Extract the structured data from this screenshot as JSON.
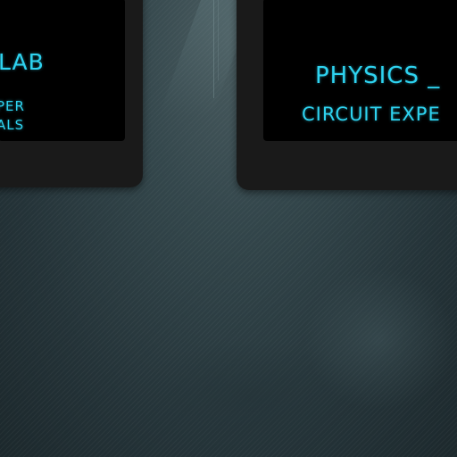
{
  "tiles": {
    "left": {
      "title_fragment": "LAB",
      "subtitle_line1": "PER",
      "subtitle_line2": "ALS"
    },
    "right": {
      "title": "PHYSICS _",
      "subtitle": "CIRCUIT EXPE"
    }
  },
  "colors": {
    "accent_text": "#2ed3f0",
    "tile_frame": "#1a1a1a",
    "tile_panel": "#000000",
    "background": "#2a3a3f"
  }
}
